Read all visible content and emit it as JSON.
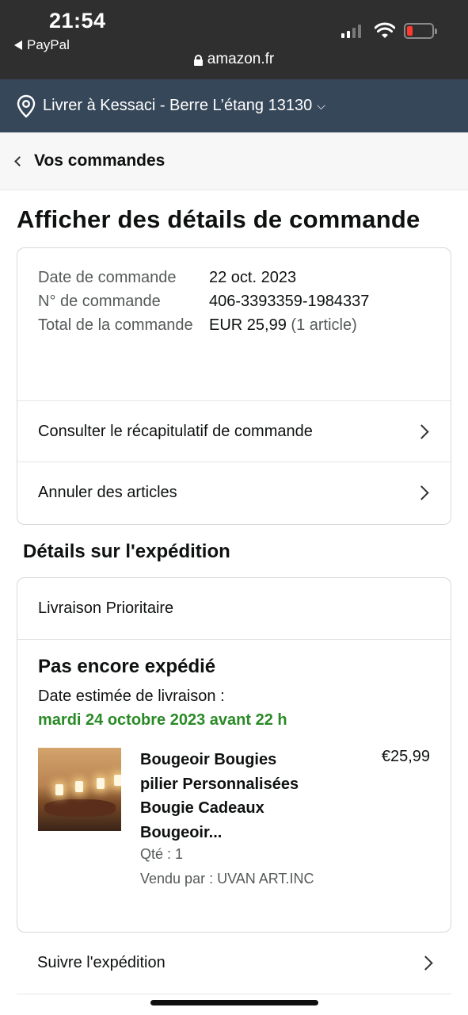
{
  "status_bar": {
    "time": "21:54",
    "back_app": "PayPal",
    "url": "amazon.fr",
    "battery_color": "#ff3b30"
  },
  "delivery": {
    "text": "Livrer à Kessaci - Berre L’étang 13130",
    "icon": "location-pin-icon"
  },
  "nav": {
    "back_label": "Vos commandes"
  },
  "page_title": "Afficher des détails de commande",
  "order": {
    "date_label": "Date de commande",
    "date_value": "22 oct. 2023",
    "number_label": "N° de commande",
    "number_value": "406-3393359-1984337",
    "total_label": "Total de la commande",
    "total_value": "EUR 25,99",
    "total_items": "(1 article)"
  },
  "order_links": {
    "summary": "Consulter le récapitulatif de commande",
    "cancel": "Annuler des articles"
  },
  "shipping": {
    "section_title": "Détails sur l'expédition",
    "type": "Livraison Prioritaire",
    "status": "Pas encore expédié",
    "est_label": "Date estimée de livraison :",
    "est_date": "mardi 24 octobre 2023 avant 22 h",
    "est_color": "#2a8a26"
  },
  "item": {
    "title_lines": [
      "Bougeoir Bougies",
      "pilier Personnalisées",
      "Bougie Cadeaux",
      "Bougeoir..."
    ],
    "price": "€25,99",
    "qty": "Qté : 1",
    "seller": "Vendu par : UVAN ART.INC"
  },
  "track": {
    "label": "Suivre l'expédition"
  },
  "colors": {
    "header_dark": "#2f2f2f",
    "delivery_bar": "#37475a",
    "border": "#d5d9d9"
  }
}
